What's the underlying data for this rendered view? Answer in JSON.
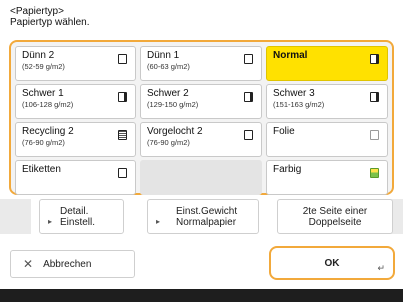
{
  "header": {
    "title": "<Papiertyp>",
    "instruction": "Papiertyp wählen."
  },
  "paper_types": [
    {
      "name": "Dünn 2",
      "sub": "(52-59 g/m2)",
      "icon": "paper-icon",
      "selected": false
    },
    {
      "name": "Dünn 1",
      "sub": "(60-63 g/m2)",
      "icon": "paper-icon",
      "selected": false
    },
    {
      "name": "Normal",
      "sub": "",
      "icon": "paper-icon",
      "selected": true
    },
    {
      "name": "Schwer 1",
      "sub": "(106-128 g/m2)",
      "icon": "paper-icon",
      "selected": false
    },
    {
      "name": "Schwer 2",
      "sub": "(129-150 g/m2)",
      "icon": "paper-icon",
      "selected": false
    },
    {
      "name": "Schwer 3",
      "sub": "(151-163 g/m2)",
      "icon": "paper-icon",
      "selected": false
    },
    {
      "name": "Recycling 2",
      "sub": "(76-90 g/m2)",
      "icon": "recycled-paper-icon",
      "selected": false
    },
    {
      "name": "Vorgelocht 2",
      "sub": "(76-90 g/m2)",
      "icon": "punched-paper-icon",
      "selected": false
    },
    {
      "name": "Folie",
      "sub": "",
      "icon": "transparency-icon",
      "selected": false
    },
    {
      "name": "Etiketten",
      "sub": "",
      "icon": "label-paper-icon",
      "selected": false
    },
    {
      "name": "Farbig",
      "sub": "",
      "icon": "colored-paper-icon",
      "selected": false
    }
  ],
  "subbar": {
    "detail_label": "Detail. Einstell.",
    "detail_line1": "Detail.",
    "detail_line2": "Einstell.",
    "weight_line1": "Einst.Gewicht",
    "weight_line2": "Normalpapier",
    "second_side_line1": "2te Seite einer",
    "second_side_line2": "Doppelseite"
  },
  "footer": {
    "cancel_label": "Abbrechen",
    "ok_label": "OK"
  },
  "colors": {
    "accent": "#f2a93b",
    "selected": "#ffe100"
  }
}
